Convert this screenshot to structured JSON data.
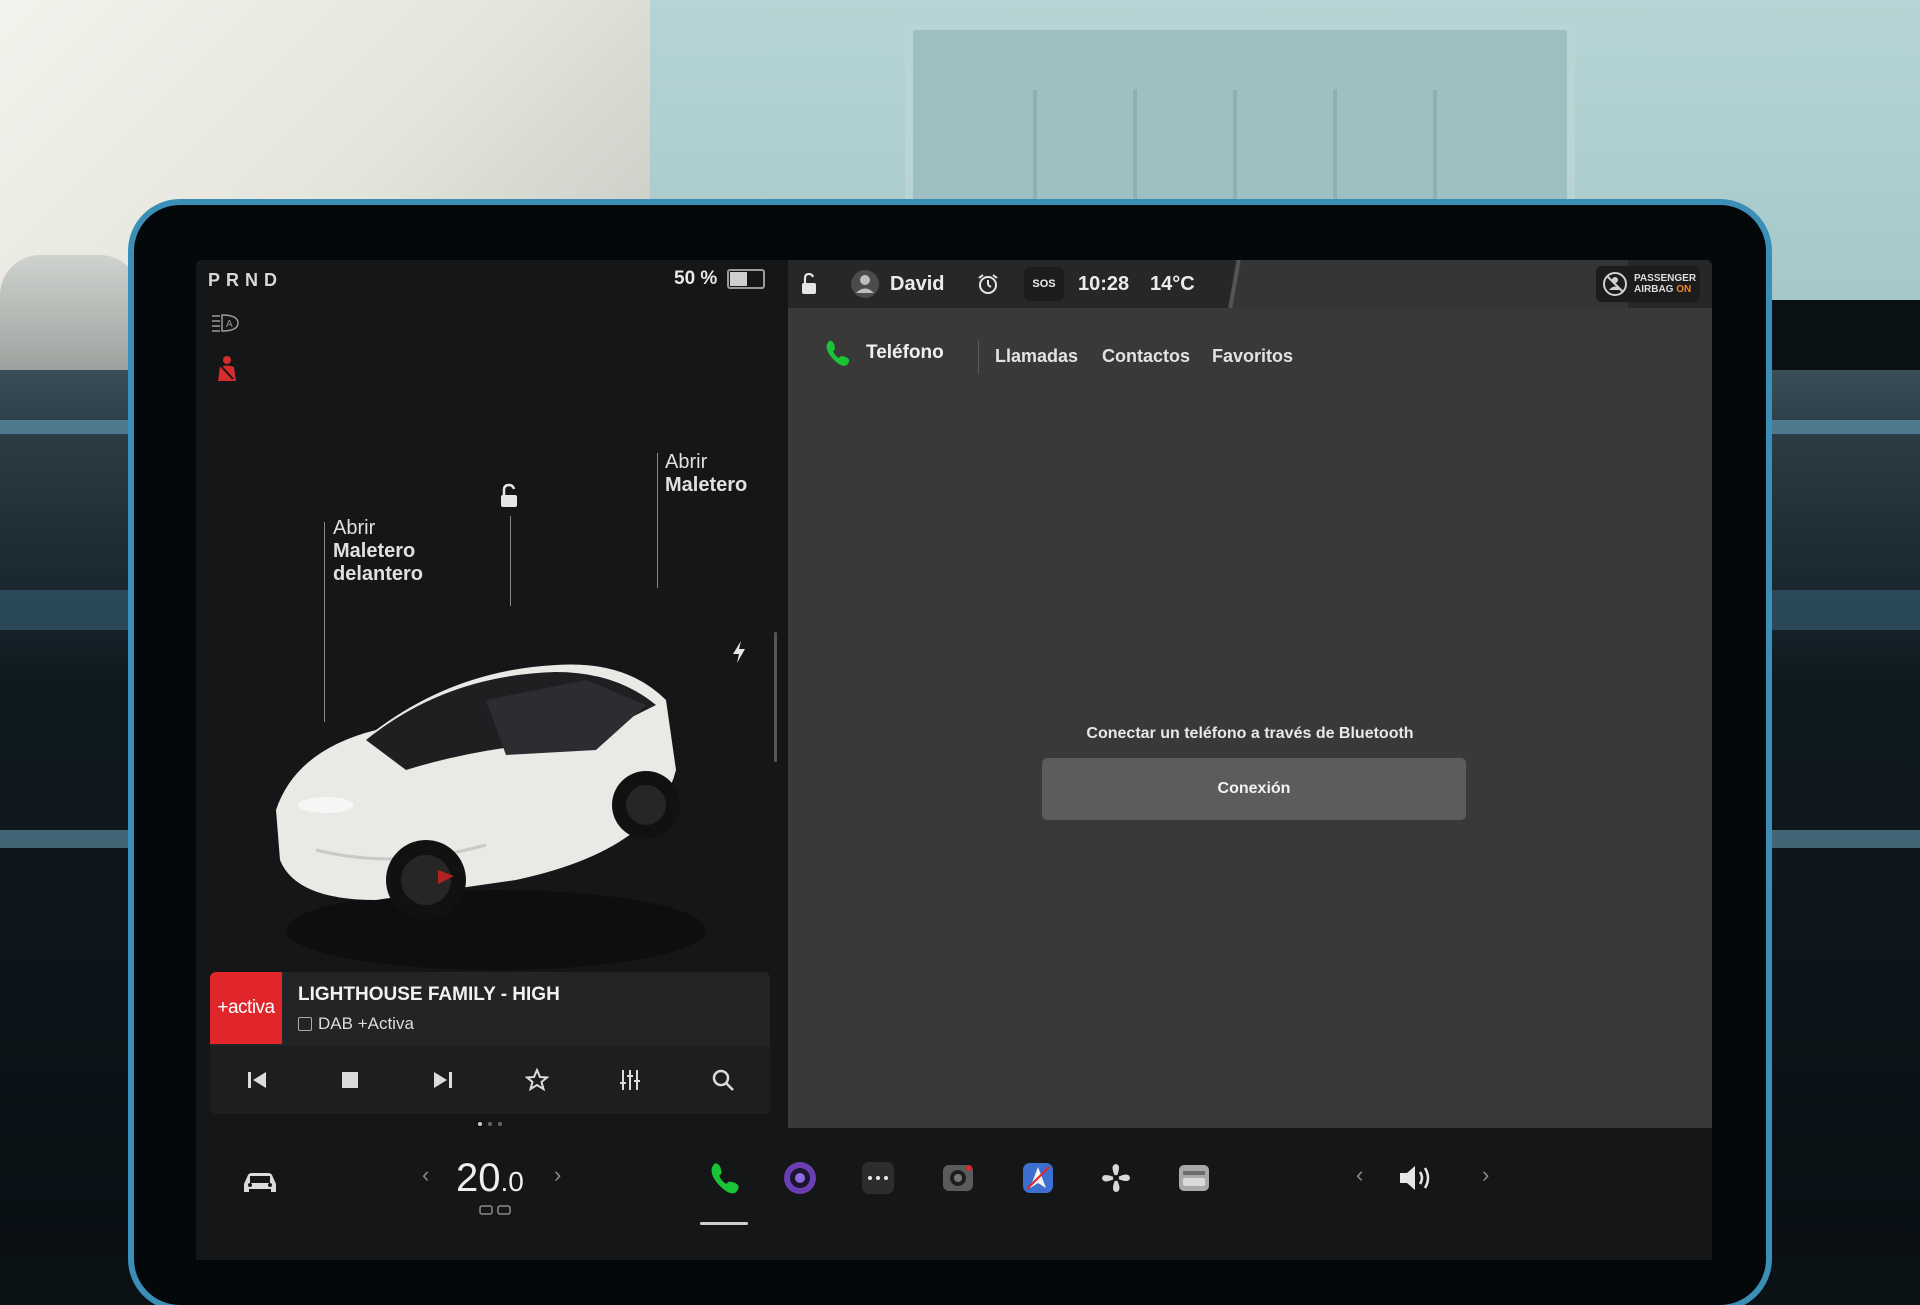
{
  "drive": {
    "gears": "PRND",
    "battery_percent": "50 %",
    "battery_level": 0.5
  },
  "car_view": {
    "frunk_label": {
      "line1": "Abrir",
      "line2": "Maletero",
      "line3": "delantero"
    },
    "trunk_label": {
      "line1": "Abrir",
      "line2": "Maletero"
    }
  },
  "media": {
    "station_logo": "+activa",
    "track_title": "LIGHTHOUSE FAMILY - HIGH",
    "source": "DAB +Activa",
    "controls": [
      "previous-icon",
      "stop-icon",
      "next-icon",
      "star-icon",
      "equalizer-icon",
      "search-icon"
    ]
  },
  "status_bar": {
    "profile_name": "David",
    "sos": "SOS",
    "time": "10:28",
    "outside_temp": "14°C",
    "airbag_line1": "PASSENGER",
    "airbag_line2": "AIRBAG",
    "airbag_state": "ON"
  },
  "phone": {
    "title": "Teléfono",
    "tabs": [
      "Llamadas",
      "Contactos",
      "Favoritos"
    ],
    "prompt": "Conectar un teléfono a través de Bluetooth",
    "connect_label": "Conexión"
  },
  "dock": {
    "temperature_whole": "20",
    "temperature_decimal": ".0",
    "apps": [
      "phone-icon",
      "camera-app-icon",
      "more-apps-icon",
      "dashcam-icon",
      "navigation-icon",
      "fan-icon",
      "toybox-icon"
    ]
  },
  "colors": {
    "accent_green": "#19c437",
    "alert_red": "#e0262b",
    "bezel_blue": "#3b8fb6"
  }
}
